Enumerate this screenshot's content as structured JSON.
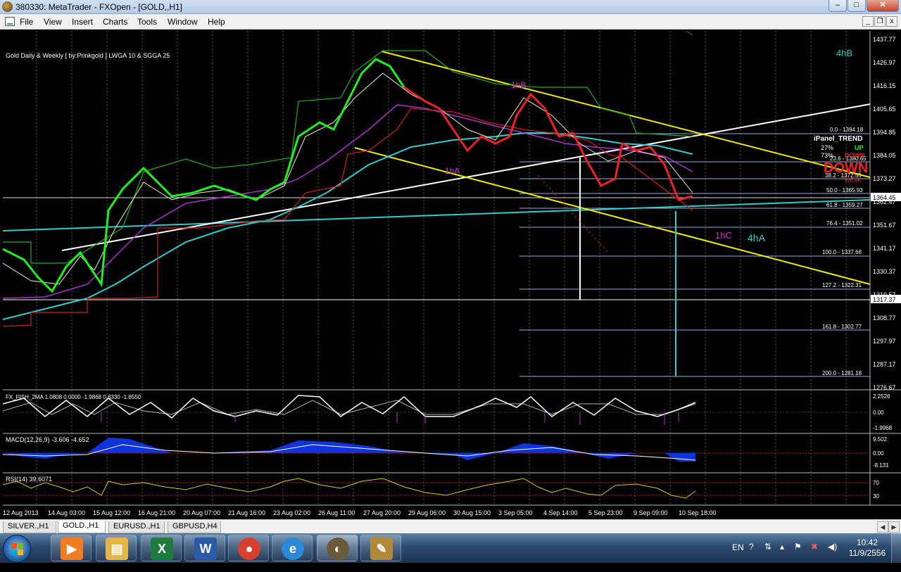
{
  "window": {
    "title": "380330: MetaTrader - FXOpen - [GOLD,,H1]",
    "minimize": "–",
    "maximize": "□",
    "close": "✕"
  },
  "menu": [
    "File",
    "View",
    "Insert",
    "Charts",
    "Tools",
    "Window",
    "Help"
  ],
  "mdi": {
    "minimize": "_",
    "restore": "❐",
    "close": "x"
  },
  "chart": {
    "header": "Gold Daily & Weekly [ by:Prinkgold ]  LWGA 10  &  SGGA 25",
    "price_axis": [
      "1437.77",
      "1426.97",
      "1416.15",
      "1405.65",
      "1394.85",
      "1384.05",
      "1373.27",
      "1362.47",
      "1351.67",
      "1341.17",
      "1330.37",
      "1319.57",
      "1308.77",
      "1297.97",
      "1287.17",
      "1276.67"
    ],
    "current_price": "1364.45",
    "hline_price": "1317.37",
    "fib_levels": [
      "0.0 - 1394.18",
      "23.6 - 1380.65",
      "38.2 - 1372.55",
      "50.0 - 1365.93",
      "61.8 - 1359.27",
      "76.4 - 1351.02",
      "100.0 - 1337.68",
      "127.2 - 1322.31",
      "161.8 - 1302.77",
      "200.0 - 1281.18"
    ],
    "annotations": {
      "4hB": "4hB",
      "1hB": "1hB",
      "1hA": "1hA",
      "1hC": "1hC",
      "4hA": "4hA"
    },
    "ipanel": {
      "title": "iPanel_TREND",
      "up_pct": "27%",
      "up_label": "UP",
      "down_pct": "73%",
      "down_label": "DOWN",
      "big": "DOWN",
      "weak": "WEAK"
    },
    "time_axis": [
      "12 Aug 2013",
      "14 Aug 03:00",
      "15 Aug 12:00",
      "16 Aug 21:00",
      "20 Aug 07:00",
      "21 Aug 16:00",
      "23 Aug 02:00",
      "26 Aug 11:00",
      "27 Aug 20:00",
      "29 Aug 06:00",
      "30 Aug 15:00",
      "3 Sep 05:00",
      "4 Sep 14:00",
      "5 Sep 23:00",
      "9 Sep 09:00",
      "10 Sep 18:00"
    ]
  },
  "indicators": {
    "fisher": {
      "label": "FX_FISH_2MA 1.0808 0.0000 -1.9868 0.8330 -1.6550",
      "scale": [
        "2.2526",
        "0.00",
        "-1.9968"
      ]
    },
    "macd": {
      "label": "MACD(12,26,9) -3.606 -4.652",
      "scale": [
        "9.502",
        "0.00",
        "-8.131"
      ]
    },
    "rsi": {
      "label": "RSI(14) 39.6071",
      "scale": [
        "70",
        "30"
      ]
    }
  },
  "symbol_tabs": [
    {
      "label": "SILVER.,H1",
      "active": false
    },
    {
      "label": "GOLD.,H1",
      "active": true
    },
    {
      "label": "EURUSD.,H1",
      "active": false
    },
    {
      "label": "GBPUSD,H4",
      "active": false
    }
  ],
  "taskbar": {
    "apps": [
      {
        "name": "media-player",
        "glyph": "▶",
        "color": "#f07c22"
      },
      {
        "name": "explorer",
        "glyph": "▤",
        "color": "#e3b64a"
      },
      {
        "name": "excel",
        "glyph": "X",
        "color": "#1f7a3d"
      },
      {
        "name": "word",
        "glyph": "W",
        "color": "#2a5aa8"
      },
      {
        "name": "chrome",
        "glyph": "●",
        "color": "#d7402f"
      },
      {
        "name": "internet-explorer",
        "glyph": "e",
        "color": "#2b8ad8"
      },
      {
        "name": "metatrader",
        "glyph": "◐",
        "color": "#6b5a3a"
      },
      {
        "name": "paint",
        "glyph": "✎",
        "color": "#b08a3a"
      }
    ],
    "language": "EN",
    "time": "10:42",
    "date": "11/9/2556"
  }
}
